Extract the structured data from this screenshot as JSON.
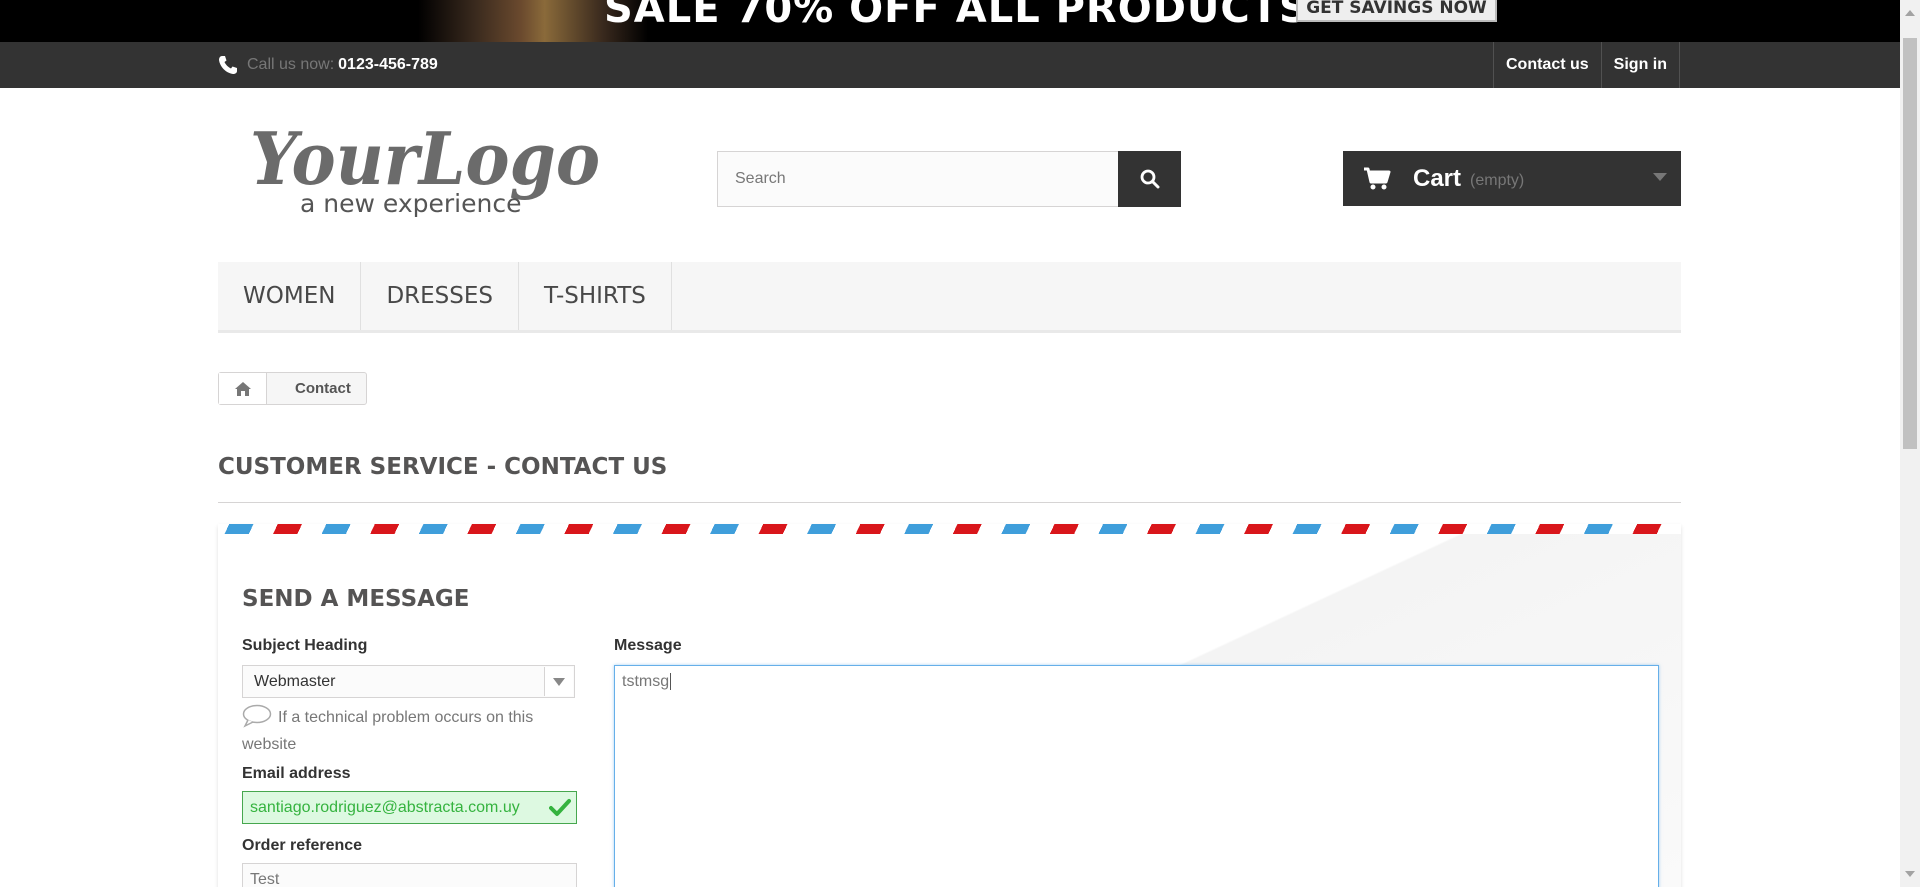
{
  "banner": {
    "text": "SALE 70% OFF ALL PRODUCTS",
    "button_label": "GET SAVINGS NOW"
  },
  "topnav": {
    "call_label": "Call us now:",
    "phone": "0123-456-789",
    "links": [
      "Contact us",
      "Sign in"
    ]
  },
  "logo": {
    "main": "YourLogo",
    "tagline": "a new experience"
  },
  "search": {
    "placeholder": "Search"
  },
  "cart": {
    "label": "Cart",
    "status": "(empty)"
  },
  "menu": {
    "items": [
      "WOMEN",
      "DRESSES",
      "T-SHIRTS"
    ]
  },
  "breadcrumb": {
    "current": "Contact"
  },
  "page": {
    "heading": "CUSTOMER SERVICE - CONTACT US"
  },
  "form": {
    "title": "SEND A MESSAGE",
    "subject_label": "Subject Heading",
    "subject_value": "Webmaster",
    "subject_hint": "If a technical problem occurs on this website",
    "email_label": "Email address",
    "email_value": "santiago.rodriguez@abstracta.com.uy",
    "order_label": "Order reference",
    "order_value": "Test",
    "message_label": "Message",
    "message_value": "tstmsg"
  },
  "colors": {
    "dark": "#333333",
    "stripe_red": "#d9161b",
    "stripe_blue": "#3f9edb",
    "valid_green": "#35b33f"
  }
}
